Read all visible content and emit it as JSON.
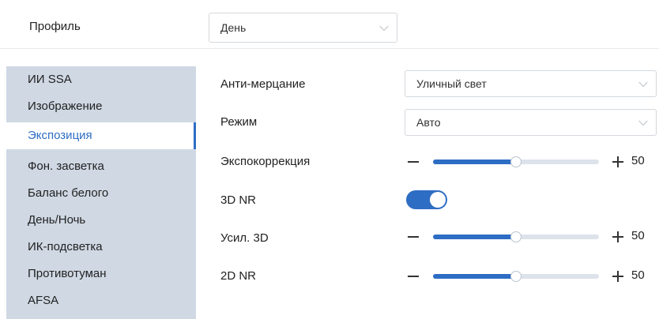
{
  "profile": {
    "label": "Профиль",
    "value": "День"
  },
  "sidebar": {
    "items": [
      {
        "label": "ИИ SSA"
      },
      {
        "label": "Изображение"
      },
      {
        "label": "Экспозиция",
        "active": true
      },
      {
        "label": "Фон. засветка"
      },
      {
        "label": "Баланс белого"
      },
      {
        "label": "День/Ночь"
      },
      {
        "label": "ИК-подсветка"
      },
      {
        "label": "Противотуман"
      },
      {
        "label": "AFSA"
      }
    ]
  },
  "form": {
    "anti_flicker": {
      "label": "Анти-мерцание",
      "value": "Уличный свет"
    },
    "mode": {
      "label": "Режим",
      "value": "Авто"
    },
    "exposure_comp": {
      "label": "Экспокоррекция",
      "value": "50",
      "fraction": 0.5
    },
    "nr3d": {
      "label": "3D NR",
      "enabled": true
    },
    "gain3d": {
      "label": "Усил. 3D",
      "value": "50",
      "fraction": 0.5
    },
    "nr2d": {
      "label": "2D NR",
      "value": "50",
      "fraction": 0.5
    }
  },
  "colors": {
    "accent": "#2e6dc4",
    "sidebar_bg": "#cfd8e3"
  }
}
